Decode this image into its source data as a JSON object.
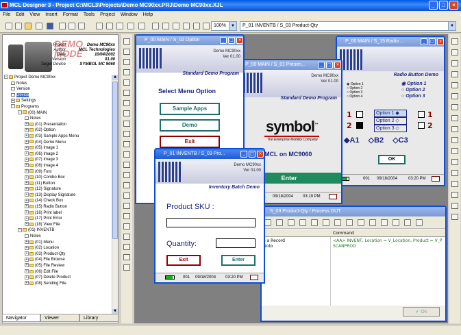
{
  "app": {
    "title": "MCL Designer 3 - Project C:\\MCL3\\Projects\\Demo MC90xx.PRJ\\Demo MC90xx.XJL"
  },
  "menu": [
    "File",
    "Edit",
    "View",
    "Insert",
    "Format",
    "Tools",
    "Project",
    "Window",
    "Help"
  ],
  "toolbar": {
    "zoom": "100%",
    "path": "P_01 INVENTB / S_03 Product-Qty"
  },
  "project_info": {
    "overlay_line1": "DEMO",
    "overlay_line2": "MODE",
    "fields": [
      {
        "label": "Project",
        "value": "Demo MC90xx"
      },
      {
        "label": "Author",
        "value": "MCL Technologies"
      },
      {
        "label": "Date",
        "value": "10/04/2002"
      },
      {
        "label": "Version",
        "value": "01.00"
      },
      {
        "label": "Target Device",
        "value": "SYMBOL MC 9060"
      }
    ]
  },
  "tree": [
    {
      "depth": 0,
      "text": "Project Demo MC90xx",
      "type": "root",
      "exp": "-"
    },
    {
      "depth": 1,
      "text": "Notes",
      "type": "doc"
    },
    {
      "depth": 1,
      "text": "Version",
      "type": "doc"
    },
    {
      "depth": 1,
      "text": "Device",
      "type": "doc",
      "selected": true
    },
    {
      "depth": 1,
      "text": "Settings",
      "type": "folder",
      "exp": "+"
    },
    {
      "depth": 1,
      "text": "Programs",
      "type": "folder",
      "exp": "-"
    },
    {
      "depth": 2,
      "text": "(00) MAIN",
      "type": "folder",
      "exp": "-"
    },
    {
      "depth": 3,
      "text": "Notes",
      "type": "doc"
    },
    {
      "depth": 3,
      "text": "(01) Presentation",
      "type": "folder",
      "exp": "+"
    },
    {
      "depth": 3,
      "text": "(02) Option",
      "type": "folder",
      "exp": "+"
    },
    {
      "depth": 3,
      "text": "(03) Sample Apps Menu",
      "type": "folder",
      "exp": "+"
    },
    {
      "depth": 3,
      "text": "(04) Demo Menu",
      "type": "folder",
      "exp": "+"
    },
    {
      "depth": 3,
      "text": "(05) Image 1",
      "type": "folder",
      "exp": "+"
    },
    {
      "depth": 3,
      "text": "(06) Image 2",
      "type": "folder",
      "exp": "+"
    },
    {
      "depth": 3,
      "text": "(07) Image 3",
      "type": "folder",
      "exp": "+"
    },
    {
      "depth": 3,
      "text": "(08) Image 4",
      "type": "folder",
      "exp": "+"
    },
    {
      "depth": 3,
      "text": "(09) Font",
      "type": "folder",
      "exp": "+"
    },
    {
      "depth": 3,
      "text": "(10) Combo Box",
      "type": "folder",
      "exp": "+"
    },
    {
      "depth": 3,
      "text": "(11) Button",
      "type": "folder",
      "exp": "+"
    },
    {
      "depth": 3,
      "text": "(12) Signature",
      "type": "folder",
      "exp": "+"
    },
    {
      "depth": 3,
      "text": "(13) Display Signature",
      "type": "folder",
      "exp": "+"
    },
    {
      "depth": 3,
      "text": "(14) Check Box",
      "type": "folder",
      "exp": "+"
    },
    {
      "depth": 3,
      "text": "(15) Radio Button",
      "type": "folder",
      "exp": "+"
    },
    {
      "depth": 3,
      "text": "(16) Print label",
      "type": "folder",
      "exp": "+"
    },
    {
      "depth": 3,
      "text": "(17) Print Error",
      "type": "folder",
      "exp": "+"
    },
    {
      "depth": 3,
      "text": "(18) View File",
      "type": "folder",
      "exp": "+"
    },
    {
      "depth": 2,
      "text": "(01) INVENTB",
      "type": "folder",
      "exp": "-"
    },
    {
      "depth": 3,
      "text": "Notes",
      "type": "doc"
    },
    {
      "depth": 3,
      "text": "(01) Menu",
      "type": "folder",
      "exp": "+"
    },
    {
      "depth": 3,
      "text": "(02) Location",
      "type": "folder",
      "exp": "+"
    },
    {
      "depth": 3,
      "text": "(03) Product-Qty",
      "type": "folder",
      "exp": "+"
    },
    {
      "depth": 3,
      "text": "(04) File Browse",
      "type": "folder",
      "exp": "+"
    },
    {
      "depth": 3,
      "text": "(05) File Review",
      "type": "folder",
      "exp": "+"
    },
    {
      "depth": 3,
      "text": "(06) Edit File",
      "type": "folder",
      "exp": "+"
    },
    {
      "depth": 3,
      "text": "(07) Delete Product",
      "type": "folder",
      "exp": "+"
    },
    {
      "depth": 3,
      "text": "(08) Sending File",
      "type": "folder",
      "exp": "+"
    }
  ],
  "left_tabs": [
    "Navigator",
    "Viewer",
    "Library"
  ],
  "phone_header": {
    "name": "Demo MC90xx",
    "ver_label": "Ver",
    "ver": "01.00"
  },
  "win_option": {
    "title": "P_00 MAIN / S_02 Option",
    "program": "Standard Demo Program",
    "heading": "Select Menu Option",
    "buttons": [
      "Sample Apps",
      "Demo",
      "Exit"
    ]
  },
  "win_presentation": {
    "title": "P_00 MAIN / S_01 Presen...",
    "program": "Standard Demo Program",
    "brand": "symbol",
    "tagline": "The Enterprise Mobility Company",
    "tm": "™",
    "device": "MCL on MC9060",
    "enter": "Enter",
    "date": "09/18/2004",
    "time": "03:19 PM",
    "code": "001"
  },
  "win_radio": {
    "title": "P_00 MAIN / S_15 Radio ...",
    "heading": "Radio Button Demo",
    "options": [
      "Option 1",
      "Option 2",
      "Option 3",
      "Option 4"
    ],
    "nums": [
      "1",
      "2"
    ],
    "choices": [
      "Option 1",
      "Option 2",
      "Option 3"
    ],
    "abc": [
      "A1",
      "B2",
      "C3"
    ],
    "ok": "OK",
    "date": "09/18/2004",
    "time": "03:20 PM",
    "code": "001"
  },
  "win_inventb": {
    "title": "P_01 INVENTB / S_03 Pro...",
    "heading": "Inventory Batch Demo",
    "sku_label": "Product SKU :",
    "qty_label": "Quantity:",
    "exit": "Exit",
    "enter": "Enter",
    "date": "09/18/2004",
    "time": "03:20 PM",
    "code": "001"
  },
  "win_process": {
    "title": "S_03 Product-Qty / Process OUT",
    "col_header": "Command",
    "rows": [
      {
        "left": "e a Record",
        "cmd": "<AA> INVENT, Location = V_Location, Product = V_P"
      },
      {
        "left": "Goto",
        "cmd": "SCANPROD"
      }
    ],
    "ok": "Ok"
  }
}
